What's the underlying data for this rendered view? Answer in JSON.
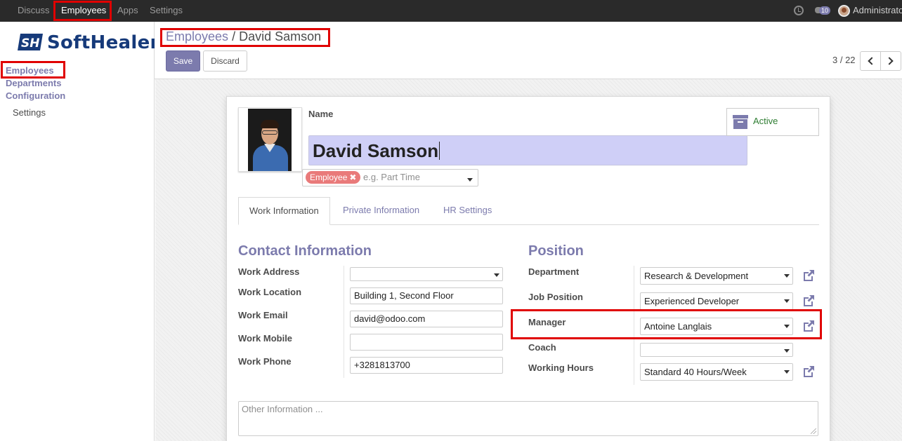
{
  "topnav": {
    "items": [
      "Discuss",
      "Employees",
      "Apps",
      "Settings"
    ],
    "active": "Employees",
    "chat_badge": "10",
    "user": "Administrator"
  },
  "sidebar": {
    "logo_text": "SoftHealer",
    "logo_mark": "SH",
    "menu": [
      "Employees",
      "Departments",
      "Configuration"
    ],
    "submenu": [
      "Settings"
    ]
  },
  "breadcrumb": {
    "parent": "Employees",
    "separator": "/",
    "current": "David Samson"
  },
  "buttons": {
    "save": "Save",
    "discard": "Discard"
  },
  "pager": {
    "value": "3 / 22"
  },
  "employee": {
    "name_label": "Name",
    "name": "David Samson",
    "tag": "Employee",
    "tag_remove": "✖",
    "tags_placeholder": "e.g. Part Time",
    "status": "Active"
  },
  "tabs": [
    "Work Information",
    "Private Information",
    "HR Settings"
  ],
  "contact": {
    "title": "Contact Information",
    "labels": [
      "Work Address",
      "Work Location",
      "Work Email",
      "Work Mobile",
      "Work Phone"
    ],
    "work_address": "",
    "work_location": "Building 1, Second Floor",
    "work_email": "david@odoo.com",
    "work_mobile": "",
    "work_phone": "+3281813700"
  },
  "position": {
    "title": "Position",
    "labels": [
      "Department",
      "Job Position",
      "Manager",
      "Coach",
      "Working Hours"
    ],
    "department": "Research & Development",
    "job_position": "Experienced Developer",
    "manager": "Antoine Langlais",
    "coach": "",
    "working_hours": "Standard 40 Hours/Week"
  },
  "notes": {
    "placeholder": "Other Information ..."
  },
  "colors": {
    "accent": "#7c7bad",
    "highlight": "#e00000",
    "active_status": "#2e7d32",
    "tag": "#e97a7a"
  }
}
